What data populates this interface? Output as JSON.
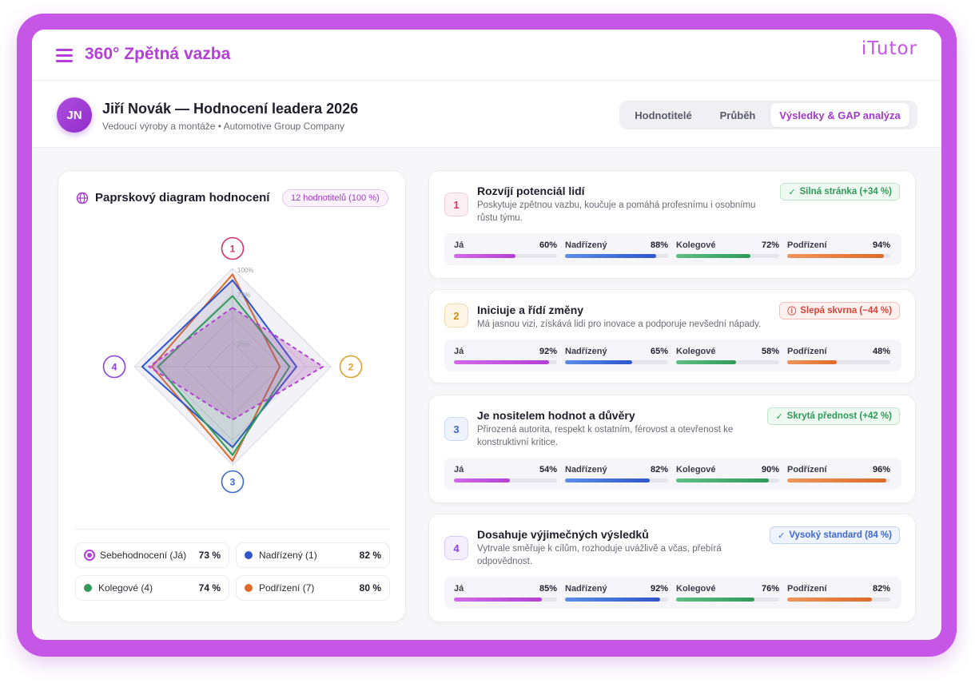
{
  "header": {
    "app_title": "360° Zpětná vazba",
    "brand": "iTutor"
  },
  "profile": {
    "initials": "JN",
    "name": "Jiří Novák — Hodnocení leadera 2026",
    "subtitle": "Vedoucí výroby a montáže • Automotive Group Company"
  },
  "tabs": [
    {
      "label": "Hodnotitelé",
      "active": false
    },
    {
      "label": "Průběh",
      "active": false
    },
    {
      "label": "Výsledky & GAP analýza",
      "active": true
    }
  ],
  "radar": {
    "title": "Paprskový diagram hodnocení",
    "badge": "12 hodnotitelů (100 %)",
    "axis_ticks": [
      "100%",
      "75%",
      "25%"
    ],
    "axes": [
      "1",
      "2",
      "3",
      "4"
    ],
    "axis_colors": [
      "#d6336c",
      "#e0a030",
      "#3e68cf",
      "#8d3fe0"
    ]
  },
  "legend": [
    {
      "label": "Sebehodnocení (Já)",
      "value": "73 %",
      "color": "#b43fd6"
    },
    {
      "label": "Nadřízený (1)",
      "value": "82 %",
      "color": "#2f56cc"
    },
    {
      "label": "Kolegové (4)",
      "value": "74 %",
      "color": "#2f9a58"
    },
    {
      "label": "Podřízení (7)",
      "value": "80 %",
      "color": "#e06a28"
    }
  ],
  "chart_data": {
    "type": "radar",
    "axes": [
      "1",
      "2",
      "3",
      "4"
    ],
    "range": [
      0,
      100
    ],
    "series": [
      {
        "name": "Sebehodnocení (Já)",
        "values": [
          60,
          92,
          54,
          85
        ],
        "color": "#b43fd6",
        "dashed": true
      },
      {
        "name": "Nadřízený (1)",
        "values": [
          88,
          65,
          82,
          92
        ],
        "color": "#2f56cc"
      },
      {
        "name": "Kolegové (4)",
        "values": [
          72,
          58,
          90,
          76
        ],
        "color": "#2f9a58"
      },
      {
        "name": "Podřízení (7)",
        "values": [
          94,
          48,
          96,
          82
        ],
        "color": "#e06a28"
      }
    ]
  },
  "bar_labels": [
    "Já",
    "Nadřízený",
    "Kolegové",
    "Podřízení"
  ],
  "competencies": [
    {
      "number": "1",
      "title": "Rozvíjí potenciál lidí",
      "description": "Poskytuje zpětnou vazbu, koučuje a pomáhá profesnímu i osobnímu růstu týmu.",
      "status": "Silná stránka (+34 %)",
      "status_icon": "✓",
      "status_type": "green",
      "values": [
        60,
        88,
        72,
        94
      ],
      "value_labels": [
        "60%",
        "88%",
        "72%",
        "94%"
      ]
    },
    {
      "number": "2",
      "title": "Iniciuje a řídí změny",
      "description": "Má jasnou vizi, získává lidi pro inovace a podporuje nevšední nápady.",
      "status": "Slepá skvrna (−44 %)",
      "status_icon": "ⓘ",
      "status_type": "red",
      "values": [
        92,
        65,
        58,
        48
      ],
      "value_labels": [
        "92%",
        "65%",
        "58%",
        "48%"
      ]
    },
    {
      "number": "3",
      "title": "Je nositelem hodnot a důvěry",
      "description": "Přirozená autorita, respekt k ostatním, férovost a otevřenost ke konstruktivní kritice.",
      "status": "Skrytá přednost (+42 %)",
      "status_icon": "✓",
      "status_type": "green",
      "values": [
        54,
        82,
        90,
        96
      ],
      "value_labels": [
        "54%",
        "82%",
        "90%",
        "96%"
      ]
    },
    {
      "number": "4",
      "title": "Dosahuje výjimečných výsledků",
      "description": "Vytrvale směřuje k cílům, rozhoduje uvážlivě a včas, přebírá odpovědnost.",
      "status": "Vysoký standard (84 %)",
      "status_icon": "✓",
      "status_type": "blue",
      "values": [
        85,
        92,
        76,
        82
      ],
      "value_labels": [
        "85%",
        "92%",
        "76%",
        "82%"
      ]
    }
  ]
}
